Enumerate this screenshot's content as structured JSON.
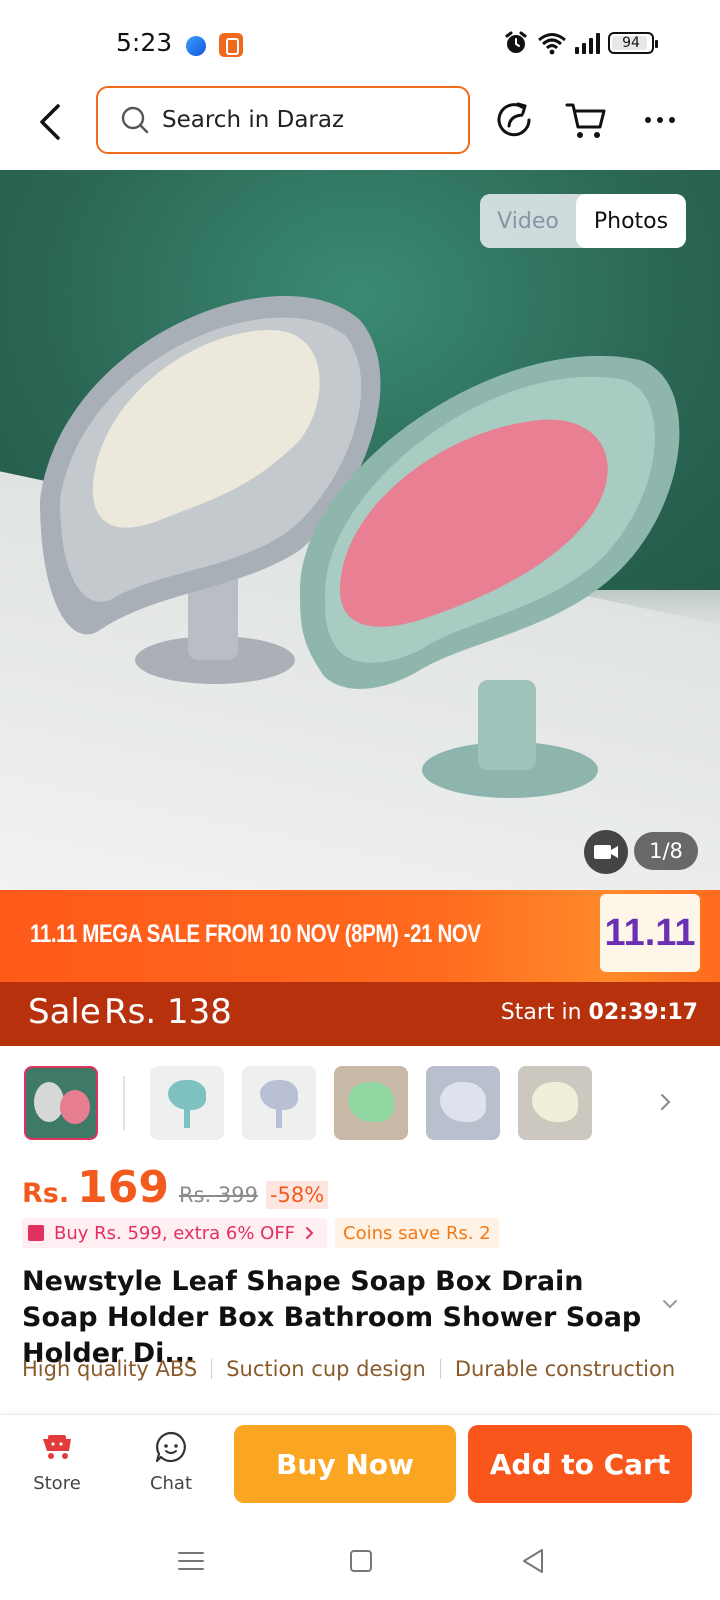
{
  "status_bar": {
    "time": "5:23",
    "battery": "94"
  },
  "header": {
    "search_placeholder": "Search in Daraz",
    "icons": [
      "back-arrow-icon",
      "search-icon",
      "share-icon",
      "cart-icon",
      "more-icon"
    ]
  },
  "gallery": {
    "toggle": {
      "video_label": "Video",
      "photos_label": "Photos",
      "selected": "Photos"
    },
    "counter": "1/8",
    "thumbnails": [
      {
        "color": "#8fb3a8",
        "active": true
      },
      {
        "color": "#7fc1c0",
        "active": false
      },
      {
        "color": "#b9c0d6",
        "active": false
      },
      {
        "color": "#8fd7a0",
        "active": false
      },
      {
        "color": "#c6cde3",
        "active": false
      },
      {
        "color": "#ece8cf",
        "active": false
      }
    ]
  },
  "banner": {
    "text": "11.11 MEGA SALE FROM 10 NOV (8PM) -21 NOV",
    "logo": "11.11"
  },
  "sale": {
    "label": "Sale",
    "price": "Rs. 138",
    "timer_prefix": "Start in",
    "timer": "02:39:17"
  },
  "price": {
    "currency": "Rs.",
    "value": "169",
    "original": "Rs. 399",
    "discount": "-58%"
  },
  "promos": {
    "voucher": "Buy Rs. 599, extra 6% OFF",
    "coins": "Coins save Rs. 2"
  },
  "product": {
    "title": "Newstyle Leaf Shape Soap Box Drain Soap Holder Box Bathroom Shower Soap Holder Di..."
  },
  "features": [
    "High quality ABS",
    "Suction cup design",
    "Durable construction"
  ],
  "bottom_bar": {
    "store_label": "Store",
    "chat_label": "Chat",
    "buy_now": "Buy Now",
    "add_to_cart": "Add to Cart"
  },
  "colors": {
    "accent": "#f8561b",
    "buy_now": "#fba623",
    "sale_bar": "#b7310d",
    "price": "#f25b1d"
  }
}
